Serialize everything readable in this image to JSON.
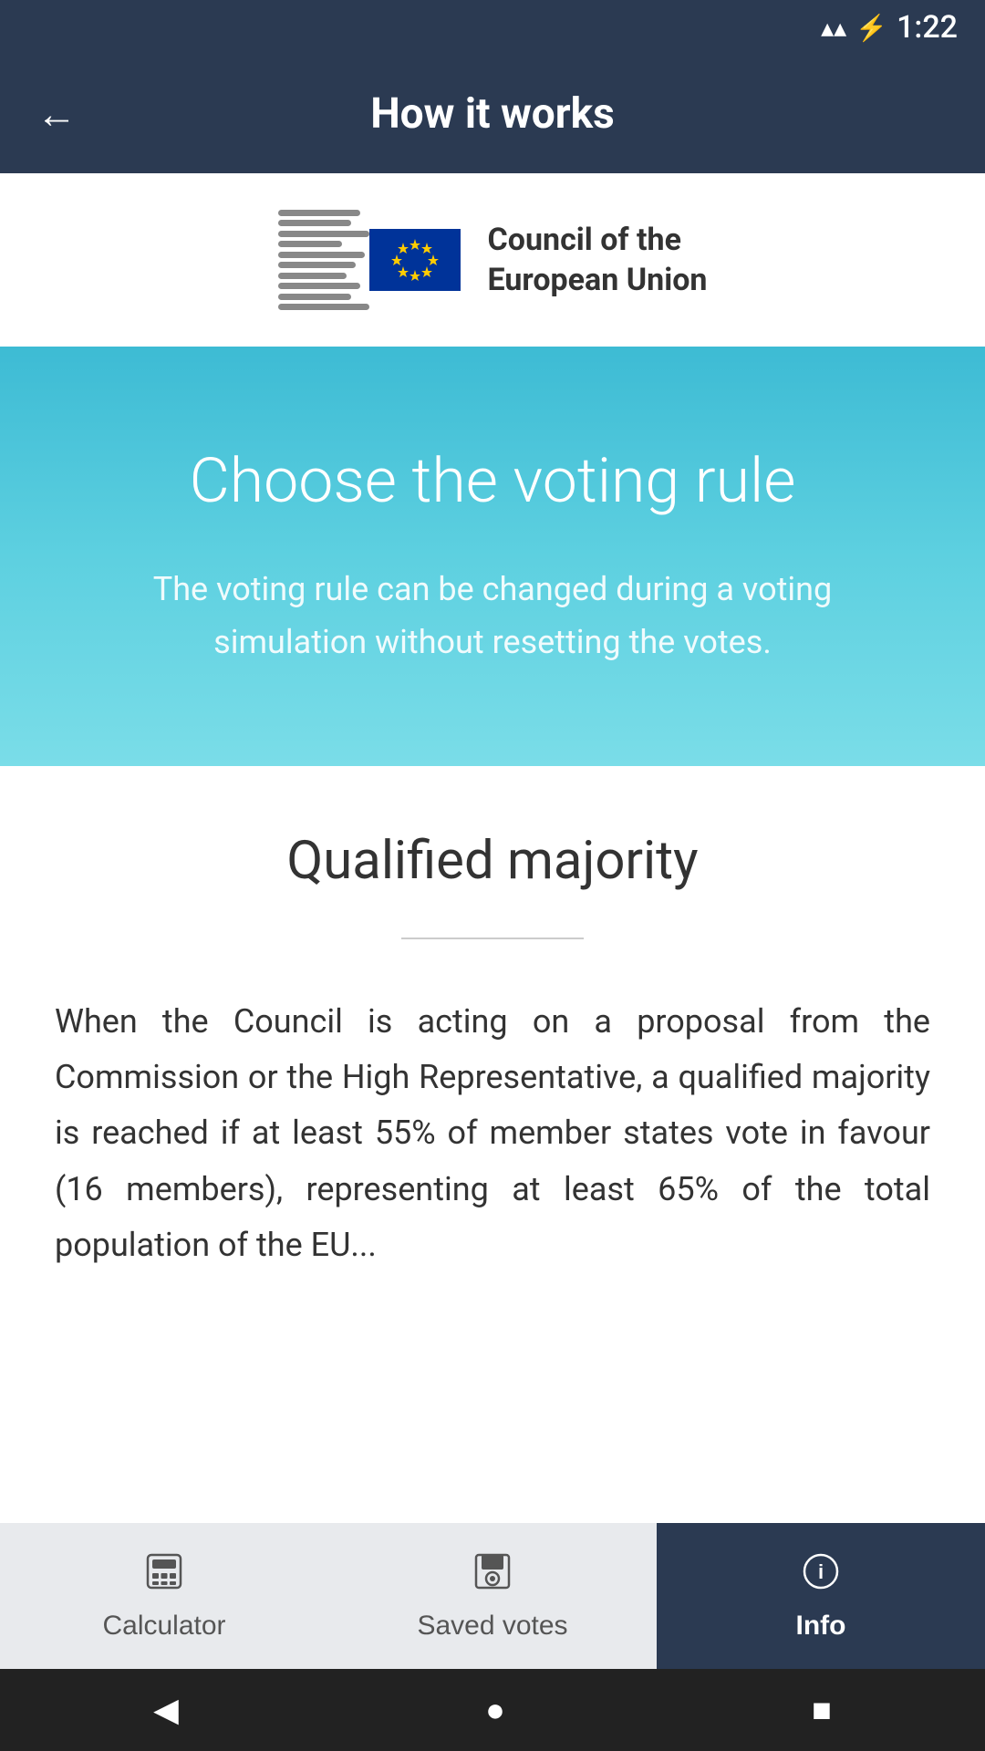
{
  "statusBar": {
    "time": "1:22",
    "wifiIcon": "▲",
    "signalIcon": "▲",
    "batteryIcon": "⚡"
  },
  "topBar": {
    "title": "How it works",
    "backLabel": "←"
  },
  "logo": {
    "orgName": "Council of the\nEuropean Union"
  },
  "hero": {
    "title": "Choose the voting rule",
    "subtitle": "The voting rule can be changed during a voting simulation without resetting the votes."
  },
  "content": {
    "sectionTitle": "Qualified majority",
    "body": "When the Council is acting on a proposal from the Commission or the High Representative, a qualified majority is reached if at least 55% of member states vote in favour (16 members), representing at least 65% of the total population of the EU..."
  },
  "bottomNav": {
    "items": [
      {
        "id": "calculator",
        "label": "Calculator",
        "icon": "▦",
        "active": false
      },
      {
        "id": "saved-votes",
        "label": "Saved votes",
        "icon": "💾",
        "active": false
      },
      {
        "id": "info",
        "label": "Info",
        "icon": "ℹ",
        "active": true
      }
    ]
  },
  "androidNav": {
    "back": "◀",
    "home": "●",
    "recent": "■"
  }
}
